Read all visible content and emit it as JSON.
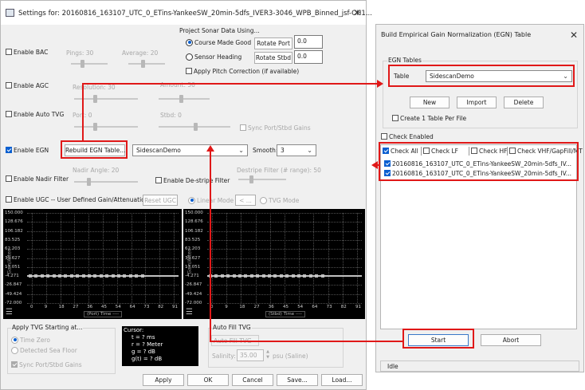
{
  "settings": {
    "title": "Settings for: 20160816_163107_UTC_0_ETins-YankeeSW_20min-5dfs_IVER3-3046_WPB_Binned_jsf-CH1...",
    "project_sonar": {
      "title": "Project Sonar Data Using...",
      "course_made_good": "Course Made Good",
      "sensor_heading": "Sensor Heading",
      "rotate_port_label": "Rotate Port",
      "rotate_port_value": "0.0",
      "rotate_stbd_label": "Rotate Stbd",
      "rotate_stbd_value": "0.0",
      "apply_pitch": "Apply Pitch Correction (if available)"
    },
    "bac": {
      "label": "Enable BAC",
      "pings": "Pings: 30",
      "average": "Average: 20"
    },
    "agc": {
      "label": "Enable AGC",
      "resolution": "Resolution: 30",
      "amount": "Amount: 50"
    },
    "auto_tvg": {
      "label": "Enable Auto TVG",
      "port": "Port: 0",
      "stbd": "Stbd: 0",
      "sync": "Sync Port/Stbd Gains"
    },
    "egn": {
      "label": "Enable EGN",
      "rebuild": "Rebuild EGN Table...",
      "table_value": "SidescanDemo",
      "smooth_label": "Smooth:",
      "smooth_value": "3"
    },
    "nadir": {
      "label": "Enable Nadir Filter",
      "angle": "Nadir Angle: 20",
      "destripe": "Enable De-stripe Filter",
      "destripe_range": "Destripe Filter (# range): 50"
    },
    "ugc": {
      "label": "Enable UGC -- User Defined Gain/Attenuation",
      "reset": "Reset UGC",
      "linear": "Linear Mode",
      "arrow_btn": "< ...",
      "tvg_mode": "TVG Mode"
    },
    "plots": {
      "ylabel": "Gain/Atten",
      "y_ticks": [
        "150.000",
        "128.676",
        "106.182",
        "83.525",
        "62.203",
        "39.627",
        "17.051",
        "-4.271",
        "-26.847",
        "-49.424",
        "-72.000"
      ],
      "x_ticks": [
        "0",
        "9",
        "18",
        "27",
        "36",
        "45",
        "54",
        "64",
        "73",
        "82",
        "91"
      ],
      "port_xlabel": "(Port) Time ----",
      "stbd_xlabel": "(Stbd) Time ----"
    },
    "apply_tvg": {
      "title": "Apply TVG Starting at...",
      "time_zero": "Time Zero",
      "detected_sea_floor": "Detected Sea Floor",
      "sync": "Sync Port/Stbd Gains"
    },
    "cursor": {
      "title": "Cursor:",
      "t": "t = ? ms",
      "r": "r = ? Meter",
      "g": "g = ? dB",
      "gt": "g(t) = ? dB"
    },
    "auto_fill": {
      "title": "Auto Fill TVG",
      "sub": "Auto Fill TVG",
      "salinity_label": "Salinity:",
      "salinity_value": "35.00",
      "salinity_unit": "psu (Saline)"
    },
    "buttons": {
      "apply": "Apply",
      "ok": "OK",
      "cancel": "Cancel",
      "save": "Save...",
      "load": "Load..."
    }
  },
  "egn_window": {
    "title": "Build Empirical Gain Normalization (EGN) Table",
    "tables_group": "EGN Tables",
    "table_label": "Table",
    "table_value": "SidescanDemo",
    "new": "New",
    "import": "Import",
    "delete": "Delete",
    "create_per_file": "Create 1 Table Per File",
    "check_enabled": "Check Enabled",
    "filters": [
      "Check All",
      "Check LF",
      "Check HF",
      "Check VHF/GapFill/MT"
    ],
    "files": [
      "20160816_163107_UTC_0_ETins-YankeeSW_20min-5dfs_IV...",
      "20160816_163107_UTC_0_ETins-YankeeSW_20min-5dfs_IV..."
    ],
    "start": "Start",
    "abort": "Abort",
    "status": "Idle"
  },
  "colors": {
    "highlight": "#e01818",
    "accent": "#0a5fd0",
    "plot_bg": "#000000",
    "curve": "#c0c0c0"
  },
  "icons": [
    "app-icon",
    "close-icon",
    "chevron-down-icon",
    "menu-icon"
  ]
}
